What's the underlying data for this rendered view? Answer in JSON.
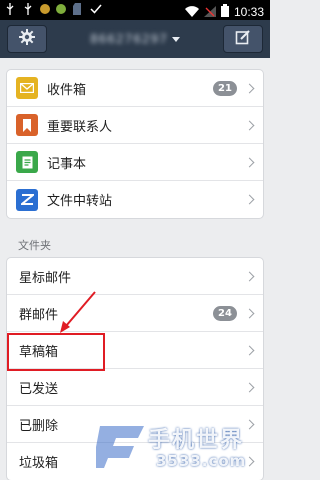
{
  "status_bar": {
    "time": "10:33"
  },
  "top_bar": {
    "account": "866276297"
  },
  "main_items": [
    {
      "label": "收件箱",
      "badge": "21",
      "icon": "inbox-icon",
      "color": "#e5b322"
    },
    {
      "label": "重要联系人",
      "badge": "",
      "icon": "bookmark-icon",
      "color": "#d9622a"
    },
    {
      "label": "记事本",
      "badge": "",
      "icon": "notes-icon",
      "color": "#3aa84a"
    },
    {
      "label": "文件中转站",
      "badge": "",
      "icon": "transfer-icon",
      "color": "#2b6fd2"
    }
  ],
  "folders_title": "文件夹",
  "folders": [
    {
      "label": "星标邮件",
      "badge": ""
    },
    {
      "label": "群邮件",
      "badge": "24"
    },
    {
      "label": "草稿箱",
      "badge": ""
    },
    {
      "label": "已发送",
      "badge": ""
    },
    {
      "label": "已删除",
      "badge": ""
    },
    {
      "label": "垃圾箱",
      "badge": ""
    }
  ],
  "watermark": {
    "title": "手机世界",
    "subtitle": "3533.com"
  },
  "colors": {
    "topbar": "#2d3b4c",
    "annotation": "#e01c24",
    "badge": "#8c9096"
  }
}
